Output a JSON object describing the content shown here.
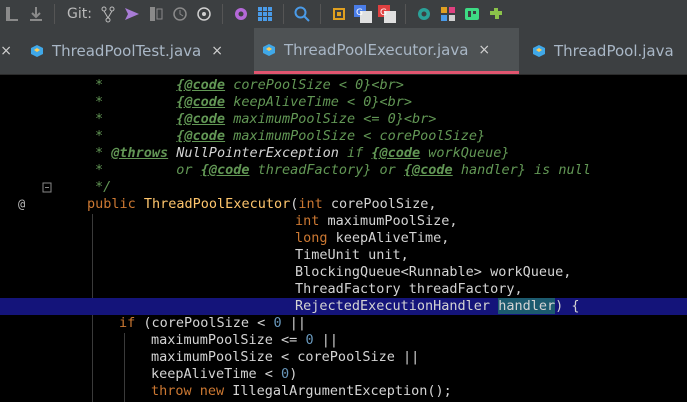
{
  "toolbar": {
    "git_label": "Git:"
  },
  "tabs": [
    {
      "label": "ThreadPoolTest.java",
      "close": "×"
    },
    {
      "label": "ThreadPoolExecutor.java",
      "close": "×"
    },
    {
      "label": "ThreadPool.java",
      "close": ""
    }
  ],
  "code": {
    "l1": {
      "star": "*",
      "gap": "         ",
      "tag": "{@code",
      "text": " corePoolSize < 0}<br>"
    },
    "l2": {
      "star": "*",
      "gap": "         ",
      "tag": "{@code",
      "text": " keepAliveTime < 0}<br>"
    },
    "l3": {
      "star": "*",
      "gap": "         ",
      "tag": "{@code",
      "text": " maximumPoolSize <= 0}<br>"
    },
    "l4": {
      "star": "*",
      "gap": "         ",
      "tag": "{@code",
      "text": " maximumPoolSize < corePoolSize}"
    },
    "l5": {
      "star": "* ",
      "throws": "@throws",
      "exc": " NullPointerException",
      "if": " if ",
      "tag": "{@code",
      "arg": " workQueue}"
    },
    "l6": {
      "star": "*",
      "or1": "         or ",
      "tag1": "{@code",
      "mid": " threadFactory} or ",
      "tag2": "{@code",
      "end": " handler} is null"
    },
    "l7": {
      "text": "*/"
    },
    "l8": {
      "kw": "public",
      "fn": " ThreadPoolExecutor",
      "p": "(",
      "t": "int",
      "rest": " corePoolSize,"
    },
    "l9": {
      "t": "int",
      "rest": " maximumPoolSize,"
    },
    "l10": {
      "t": "long",
      "rest": " keepAliveTime,"
    },
    "l11": {
      "text": "TimeUnit unit,"
    },
    "l12": {
      "text": "BlockingQueue<Runnable> workQueue,"
    },
    "l13": {
      "text": "ThreadFactory threadFactory,"
    },
    "l14": {
      "text": "RejectedExecutionHandler ",
      "sel": "handler",
      "end": ") {"
    },
    "l15": {
      "kw": "if",
      "a": " (corePoolSize < ",
      "n": "0",
      "b": " ||"
    },
    "l16": {
      "a": "maximumPoolSize <= ",
      "n": "0",
      "b": " ||"
    },
    "l17": {
      "a": "maximumPoolSize < corePoolSize ||"
    },
    "l18": {
      "a": "keepAliveTime < ",
      "n": "0",
      "b": ")"
    },
    "l19": {
      "kw1": "throw",
      "kw2": " new",
      "rest": " IllegalArgumentException();"
    }
  },
  "gutter": {
    "override_marker": "@"
  },
  "colors": {
    "highlight": "#14147a",
    "keyword": "#cc7832",
    "function": "#ffc66d",
    "number": "#6897bb",
    "comment": "#629755"
  }
}
